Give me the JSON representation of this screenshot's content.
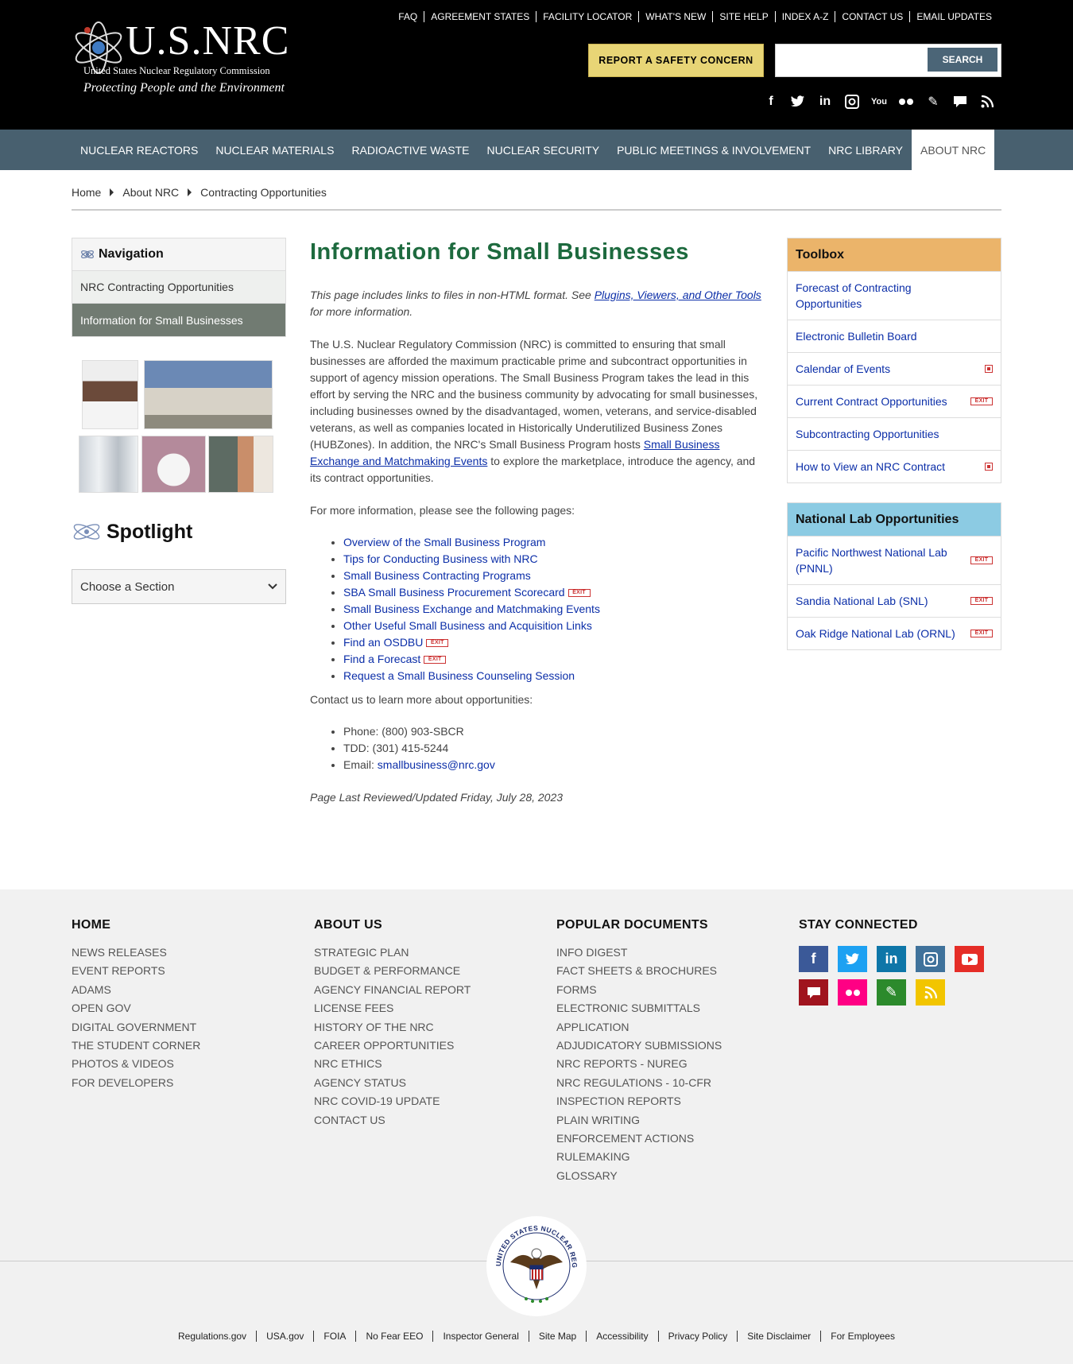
{
  "header": {
    "logo_main": "U.S.NRC",
    "logo_sub": "United States Nuclear Regulatory Commission",
    "logo_tag": "Protecting People and the Environment",
    "utility_links": [
      "FAQ",
      "AGREEMENT STATES",
      "FACILITY LOCATOR",
      "WHAT'S NEW",
      "SITE HELP",
      "INDEX A-Z",
      "CONTACT US",
      "EMAIL UPDATES"
    ],
    "report_button": "REPORT A SAFETY CONCERN",
    "search_placeholder": "",
    "search_button": "SEARCH",
    "social_icons": [
      "facebook-icon",
      "twitter-icon",
      "linkedin-icon",
      "instagram-icon",
      "youtube-icon",
      "flickr-icon",
      "blog-icon",
      "comment-icon",
      "rss-icon"
    ]
  },
  "nav": {
    "items": [
      "NUCLEAR REACTORS",
      "NUCLEAR MATERIALS",
      "RADIOACTIVE WASTE",
      "NUCLEAR SECURITY",
      "PUBLIC MEETINGS & INVOLVEMENT",
      "NRC LIBRARY",
      "ABOUT NRC"
    ],
    "active": "ABOUT NRC"
  },
  "breadcrumb": [
    "Home",
    "About NRC",
    "Contracting Opportunities"
  ],
  "left": {
    "nav_title": "Navigation",
    "nav_items": [
      "NRC Contracting Opportunities",
      "Information for Small Businesses"
    ],
    "spotlight_title": "Spotlight",
    "choose_label": "Choose a Section"
  },
  "main": {
    "title": "Information for Small Businesses",
    "note_prefix": "This page includes links to files in non-HTML format. See ",
    "note_link": "Plugins, Viewers, and Other Tools",
    "note_suffix": " for more information.",
    "intro": "The U.S. Nuclear Regulatory Commission (NRC) is committed to ensuring that small businesses are afforded the maximum practicable prime and subcontract opportunities in support of agency mission operations. The Small Business Program takes the lead in this effort by serving the NRC and the business community by advocating for small businesses, including businesses owned by the disadvantaged, women, veterans, and service-disabled veterans, as well as companies located in Historically Underutilized Business Zones (HUBZones). In addition, the NRC's Small Business Program hosts ",
    "intro_link": "Small Business Exchange and Matchmaking Events",
    "intro_suffix": " to explore the marketplace, introduce the agency, and its contract opportunities.",
    "more_info": "For more information, please see the following pages:",
    "links": [
      {
        "label": "Overview of the Small Business Program",
        "exit": false
      },
      {
        "label": "Tips for Conducting Business with NRC",
        "exit": false
      },
      {
        "label": "Small Business Contracting Programs",
        "exit": false
      },
      {
        "label": "SBA Small Business Procurement Scorecard",
        "exit": true
      },
      {
        "label": "Small Business Exchange and Matchmaking Events",
        "exit": false
      },
      {
        "label": "Other Useful Small Business and Acquisition Links",
        "exit": false
      },
      {
        "label": "Find an OSDBU",
        "exit": true
      },
      {
        "label": "Find a Forecast",
        "exit": true
      },
      {
        "label": "Request a Small Business Counseling Session",
        "exit": false
      }
    ],
    "contact_intro": "Contact us to learn more about opportunities:",
    "phone": "Phone: (800) 903-SBCR",
    "tdd": "TDD: (301) 415-5244",
    "email_label": "Email: ",
    "email": "smallbusiness@nrc.gov",
    "last_updated": "Page Last Reviewed/Updated Friday, July 28, 2023",
    "exit_text": "EXIT"
  },
  "toolbox": {
    "title": "Toolbox",
    "header_color": "#ebb46a",
    "items": [
      {
        "label": "Forecast of Contracting Opportunities",
        "badge": ""
      },
      {
        "label": "Electronic Bulletin Board",
        "badge": ""
      },
      {
        "label": "Calendar of Events",
        "badge": "pdf"
      },
      {
        "label": "Current Contract Opportunities",
        "badge": "exit"
      },
      {
        "label": "Subcontracting Opportunities",
        "badge": ""
      },
      {
        "label": "How to View an NRC Contract",
        "badge": "pdf"
      }
    ]
  },
  "labs": {
    "title": "National Lab Opportunities",
    "header_color": "#8ccbe3",
    "items": [
      {
        "label": "Pacific Northwest National Lab (PNNL)",
        "badge": "exit"
      },
      {
        "label": "Sandia National Lab (SNL)",
        "badge": "exit"
      },
      {
        "label": "Oak Ridge National Lab (ORNL)",
        "badge": "exit"
      }
    ]
  },
  "footer": {
    "col1": {
      "title": "HOME",
      "links": [
        "NEWS RELEASES",
        "EVENT REPORTS",
        "ADAMS",
        "OPEN GOV",
        "DIGITAL GOVERNMENT",
        "THE STUDENT CORNER",
        "PHOTOS & VIDEOS",
        "FOR DEVELOPERS"
      ]
    },
    "col2": {
      "title": "ABOUT US",
      "links": [
        "STRATEGIC PLAN",
        "BUDGET & PERFORMANCE",
        "AGENCY FINANCIAL REPORT",
        "LICENSE FEES",
        "HISTORY OF THE NRC",
        "CAREER OPPORTUNITIES",
        "NRC ETHICS",
        "AGENCY STATUS",
        "NRC COVID-19 UPDATE",
        "CONTACT US"
      ]
    },
    "col3": {
      "title": "POPULAR DOCUMENTS",
      "links": [
        "INFO DIGEST",
        "FACT SHEETS & BROCHURES",
        "FORMS",
        "ELECTRONIC SUBMITTALS",
        "APPLICATION",
        "ADJUDICATORY SUBMISSIONS",
        "NRC REPORTS - NUREG",
        "NRC REGULATIONS - 10-CFR",
        "INSPECTION REPORTS",
        "PLAIN WRITING",
        "ENFORCEMENT ACTIONS",
        "RULEMAKING",
        "GLOSSARY"
      ]
    },
    "col4": {
      "title": "STAY CONNECTED"
    },
    "social": [
      {
        "icon": "facebook-icon",
        "color": "#3b5998",
        "glyph": "f"
      },
      {
        "icon": "twitter-icon",
        "color": "#1da1f2",
        "glyph": "t"
      },
      {
        "icon": "linkedin-icon",
        "color": "#0e76a8",
        "glyph": "in"
      },
      {
        "icon": "instagram-icon",
        "color": "#3f729b",
        "glyph": "◎"
      },
      {
        "icon": "youtube-icon",
        "color": "#e52d27",
        "glyph": "▶"
      },
      {
        "icon": "comment-icon",
        "color": "#a0141e",
        "glyph": "▬"
      },
      {
        "icon": "flickr-icon",
        "color": "#ff0084",
        "glyph": "●●"
      },
      {
        "icon": "blog-icon",
        "color": "#2c8a2c",
        "glyph": "✎"
      },
      {
        "icon": "rss-icon",
        "color": "#f2c500",
        "glyph": ")))"
      }
    ],
    "seal_text": "UNITED STATES NUCLEAR REGULATORY COMMISSION",
    "bottom_links": [
      "Regulations.gov",
      "USA.gov",
      "FOIA",
      "No Fear EEO",
      "Inspector General",
      "Site Map",
      "Accessibility",
      "Privacy Policy",
      "Site Disclaimer",
      "For Employees"
    ]
  }
}
